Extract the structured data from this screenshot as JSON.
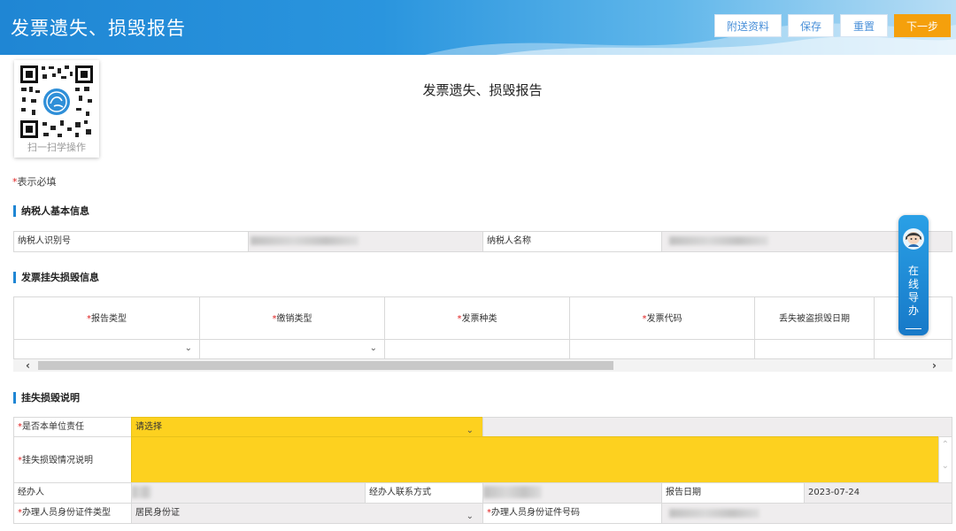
{
  "header": {
    "title": "发票遗失、损毁报告",
    "buttons": {
      "attach": "附送资料",
      "save": "保存",
      "reset": "重置",
      "next": "下一步"
    }
  },
  "qr": {
    "caption": "扫一扫学操作"
  },
  "document_title": "发票遗失、损毁报告",
  "required_note": {
    "star": "*",
    "text": "表示必填"
  },
  "sections": {
    "taxpayer": {
      "title": "纳税人基本信息",
      "id_label": "纳税人识别号",
      "name_label": "纳税人名称"
    },
    "invoice": {
      "title": "发票挂失损毁信息",
      "columns": [
        {
          "star": "*",
          "label": "报告类型"
        },
        {
          "star": "*",
          "label": "缴销类型"
        },
        {
          "star": "*",
          "label": "发票种类"
        },
        {
          "star": "*",
          "label": "发票代码"
        },
        {
          "star": "",
          "label": "丢失被盗损毁日期"
        }
      ]
    },
    "description": {
      "title": "挂失损毁说明",
      "responsibility_label": "是否本单位责任",
      "responsibility_value": "请选择",
      "situation_label": "挂失损毁情况说明",
      "handler_label": "经办人",
      "contact_label": "经办人联系方式",
      "report_date_label": "报告日期",
      "report_date_value": "2023-07-24",
      "id_type_label": "办理人员身份证件类型",
      "id_type_value": "居民身份证",
      "id_number_label": "办理人员身份证件号码"
    }
  },
  "guide": {
    "chars": [
      "在",
      "线",
      "导",
      "办"
    ]
  },
  "colors": {
    "header_blue": "#1f86d4",
    "required_yellow": "#fdd11f",
    "next_button": "#f5a00c",
    "required_star": "#e02020"
  }
}
